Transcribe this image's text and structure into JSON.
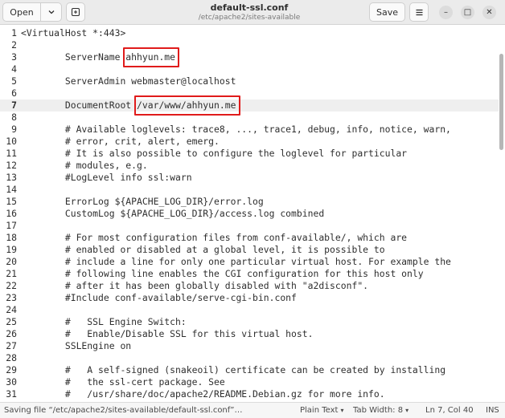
{
  "header": {
    "open_label": "Open",
    "open_menu_icon": "chevron-down-icon",
    "new_tab_icon": "new-tab-icon",
    "title": "default-ssl.conf",
    "subtitle": "/etc/apache2/sites-available",
    "save_label": "Save",
    "menu_icon": "hamburger-icon",
    "minimize_glyph": "–",
    "maximize_glyph": "□",
    "close_glyph": "✕"
  },
  "editor": {
    "current_line": 7,
    "lines": [
      {
        "n": "1",
        "text": "<VirtualHost *:443>"
      },
      {
        "n": "2",
        "text": ""
      },
      {
        "n": "3",
        "text": "        ServerName ahhyun.me"
      },
      {
        "n": "4",
        "text": ""
      },
      {
        "n": "5",
        "text": "        ServerAdmin webmaster@localhost"
      },
      {
        "n": "6",
        "text": ""
      },
      {
        "n": "7",
        "text": "        DocumentRoot /var/www/ahhyun.me"
      },
      {
        "n": "8",
        "text": ""
      },
      {
        "n": "9",
        "text": "        # Available loglevels: trace8, ..., trace1, debug, info, notice, warn,"
      },
      {
        "n": "10",
        "text": "        # error, crit, alert, emerg."
      },
      {
        "n": "11",
        "text": "        # It is also possible to configure the loglevel for particular"
      },
      {
        "n": "12",
        "text": "        # modules, e.g."
      },
      {
        "n": "13",
        "text": "        #LogLevel info ssl:warn"
      },
      {
        "n": "14",
        "text": ""
      },
      {
        "n": "15",
        "text": "        ErrorLog ${APACHE_LOG_DIR}/error.log"
      },
      {
        "n": "16",
        "text": "        CustomLog ${APACHE_LOG_DIR}/access.log combined"
      },
      {
        "n": "17",
        "text": ""
      },
      {
        "n": "18",
        "text": "        # For most configuration files from conf-available/, which are"
      },
      {
        "n": "19",
        "text": "        # enabled or disabled at a global level, it is possible to"
      },
      {
        "n": "20",
        "text": "        # include a line for only one particular virtual host. For example the"
      },
      {
        "n": "21",
        "text": "        # following line enables the CGI configuration for this host only"
      },
      {
        "n": "22",
        "text": "        # after it has been globally disabled with \"a2disconf\"."
      },
      {
        "n": "23",
        "text": "        #Include conf-available/serve-cgi-bin.conf"
      },
      {
        "n": "24",
        "text": ""
      },
      {
        "n": "25",
        "text": "        #   SSL Engine Switch:"
      },
      {
        "n": "26",
        "text": "        #   Enable/Disable SSL for this virtual host."
      },
      {
        "n": "27",
        "text": "        SSLEngine on"
      },
      {
        "n": "28",
        "text": ""
      },
      {
        "n": "29",
        "text": "        #   A self-signed (snakeoil) certificate can be created by installing"
      },
      {
        "n": "30",
        "text": "        #   the ssl-cert package. See"
      },
      {
        "n": "31",
        "text": "        #   /usr/share/doc/apache2/README.Debian.gz for more info."
      }
    ],
    "highlights": [
      {
        "line": 3,
        "text": "ahhyun.me"
      },
      {
        "line": 7,
        "text": "/var/www/ahhyun.me"
      }
    ],
    "highlight_color": "#e01b1b"
  },
  "status": {
    "message": "Saving file “/etc/apache2/sites-available/default-ssl.conf”…",
    "language": "Plain Text",
    "tab_width": "Tab Width: 8",
    "position": "Ln 7, Col 40",
    "mode": "INS"
  }
}
